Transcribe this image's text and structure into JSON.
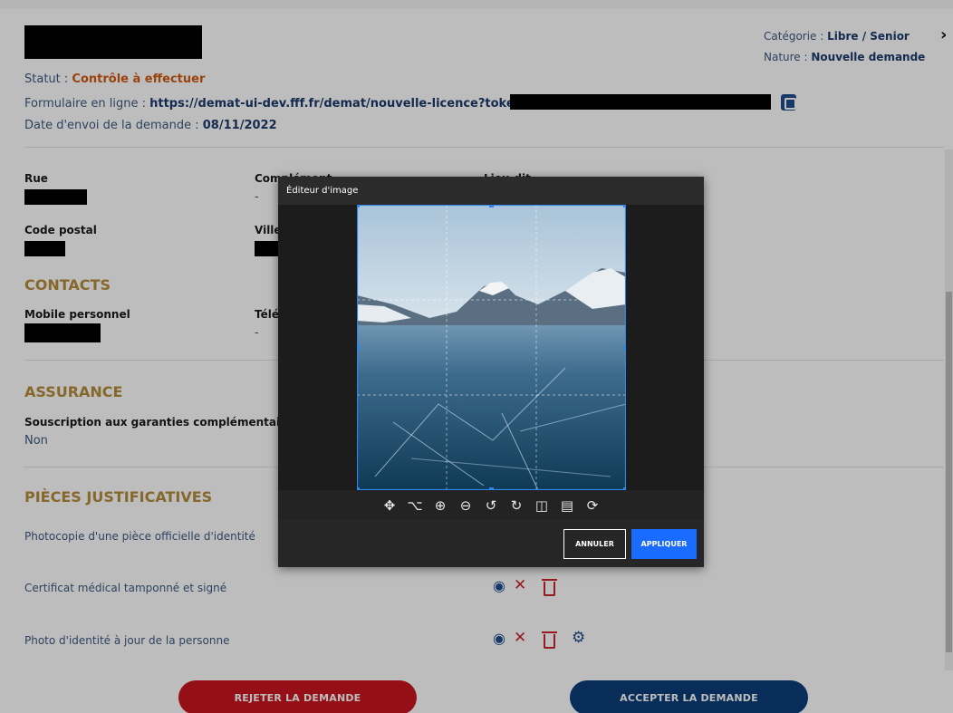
{
  "header": {
    "statut_label": "Statut : ",
    "statut_value": "Contrôle à effectuer",
    "form_label": "Formulaire en ligne : ",
    "form_url": "https://demat-ui-dev.fff.fr/demat/nouvelle-licence?token=",
    "date_label": "Date d'envoi de la demande : ",
    "date_value": "08/11/2022",
    "categorie_label": "Catégorie : ",
    "categorie_value": "Libre / Senior",
    "nature_label": "Nature : ",
    "nature_value": "Nouvelle demande",
    "close_glyph": "›"
  },
  "address": {
    "rue_label": "Rue",
    "complement_label": "Complément",
    "complement_value": "-",
    "lieudit_label": "Lieu-dit",
    "codepostal_label": "Code postal",
    "ville_label": "Ville"
  },
  "contacts": {
    "title": "CONTACTS",
    "mobile_label": "Mobile personnel",
    "tel_label": "Télé",
    "tel_value": "-"
  },
  "assurance": {
    "title": "ASSURANCE",
    "souscription_label": "Souscription aux garanties complémentaires",
    "souscription_value": "Non"
  },
  "pieces": {
    "title": "PIÈCES JUSTIFICATIVES",
    "items": [
      {
        "label": "Photocopie d'une pièce officielle d'identité"
      },
      {
        "label": "Certificat médical tamponné et signé"
      },
      {
        "label": "Photo d'identité à jour de la personne"
      }
    ]
  },
  "actions": {
    "reject_label": "REJETER LA DEMANDE",
    "accept_label": "ACCEPTER LA DEMANDE"
  },
  "editor": {
    "title": "Éditeur d'image",
    "cancel_label": "ANNULER",
    "apply_label": "APPLIQUER",
    "tools": [
      "move-icon",
      "crop-icon",
      "zoom-in-icon",
      "zoom-out-icon",
      "rotate-left-icon",
      "rotate-right-icon",
      "flip-horizontal-icon",
      "flip-vertical-icon",
      "reset-icon"
    ]
  },
  "colors": {
    "accent_navy": "#0b3d78",
    "danger_red": "#c9151e",
    "section_gold": "#b58c3c",
    "status_orange": "#d05a12",
    "apply_blue": "#1a6cff"
  }
}
